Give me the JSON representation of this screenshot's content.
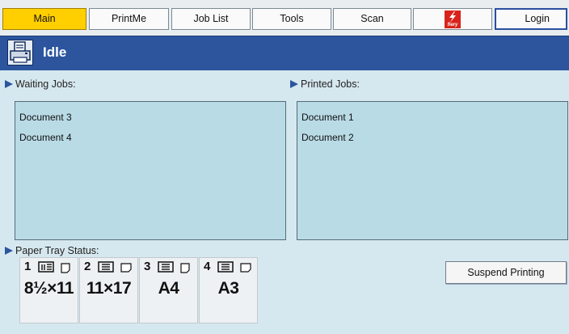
{
  "tabs": {
    "main": "Main",
    "printme": "PrintMe",
    "joblist": "Job List",
    "tools": "Tools",
    "scan": "Scan",
    "fiery_logo_text": "fiery",
    "login": "Login"
  },
  "status": {
    "title": "Idle",
    "icon": "printer-icon",
    "header_color": "#2c559e"
  },
  "waiting": {
    "label": "Waiting Jobs:",
    "jobs": [
      "Document 3",
      "Document 4"
    ]
  },
  "printed": {
    "label": "Printed Jobs:",
    "jobs": [
      "Document 1",
      "Document 2"
    ]
  },
  "paper_trays": {
    "label": "Paper Tray Status:",
    "trays": [
      {
        "number": "1",
        "size": "8½×11",
        "orientation": "portrait"
      },
      {
        "number": "2",
        "size": "11×17",
        "orientation": "landscape"
      },
      {
        "number": "3",
        "size": "A4",
        "orientation": "portrait"
      },
      {
        "number": "4",
        "size": "A3",
        "orientation": "landscape"
      }
    ]
  },
  "actions": {
    "suspend": "Suspend Printing"
  },
  "colors": {
    "active_tab": "#ffcf00",
    "list_background": "#b9dbe6",
    "page_background": "#d6e8ef"
  }
}
